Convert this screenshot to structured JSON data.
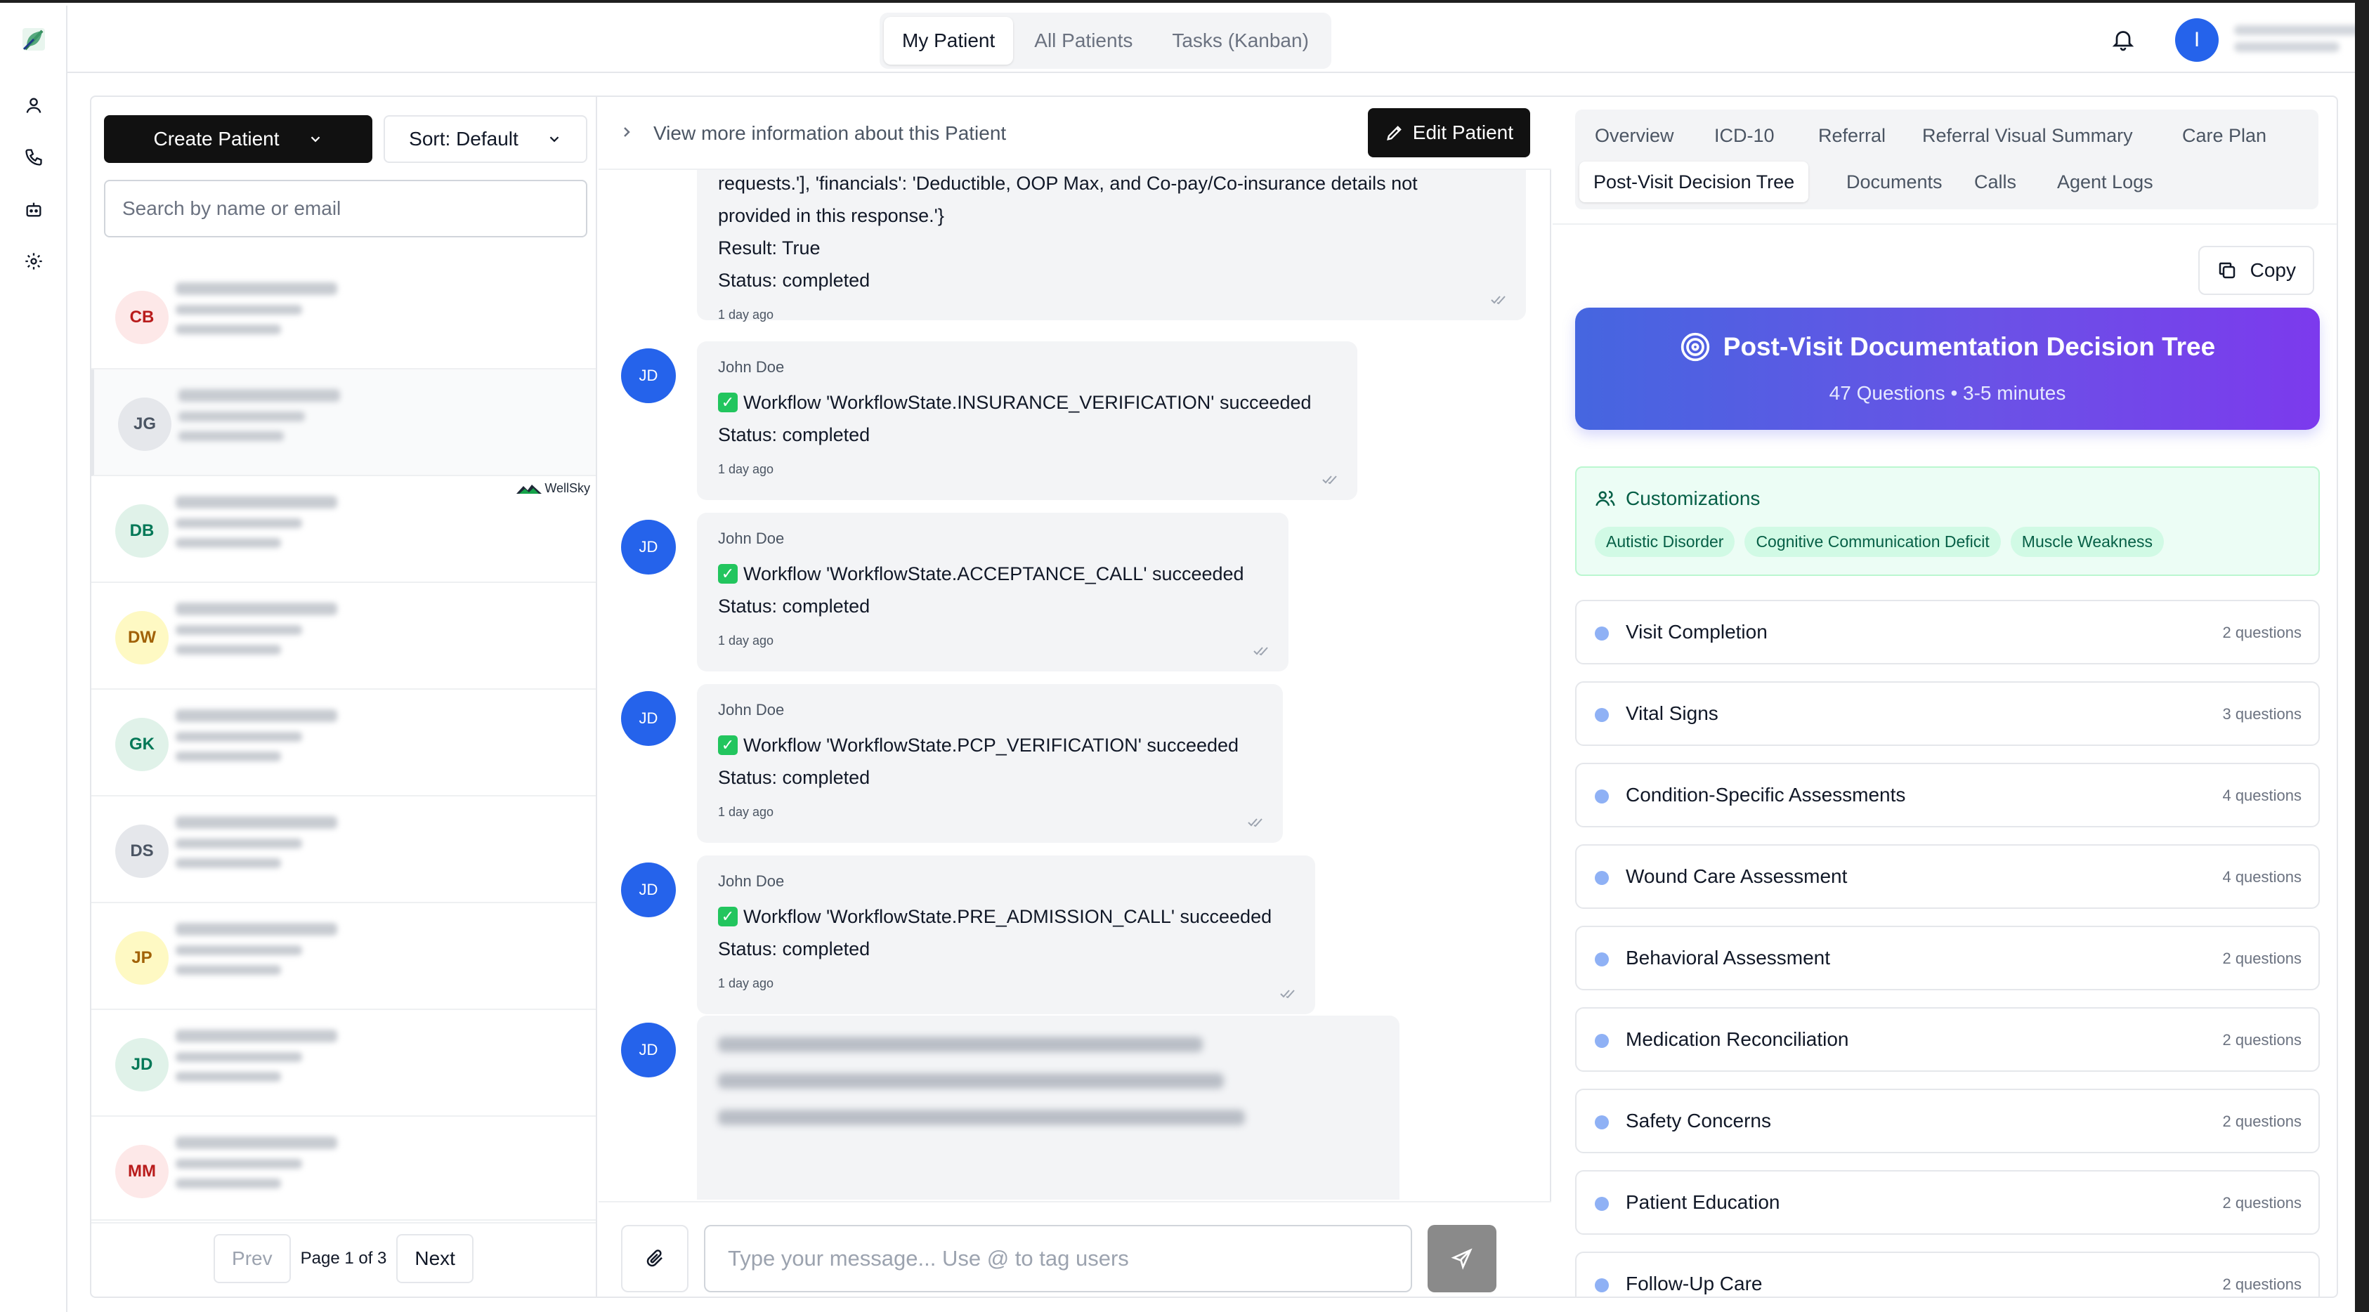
{
  "app": {
    "accent": "#2563eb",
    "brand_icon": "leaf-logo-icon"
  },
  "topbar": {
    "tabs": [
      {
        "label": "My Patient",
        "active": true
      },
      {
        "label": "All Patients",
        "active": false
      },
      {
        "label": "Tasks (Kanban)",
        "active": false
      }
    ],
    "user_initial": "I"
  },
  "patient_list": {
    "create_label": "Create Patient",
    "sort_label": "Sort: Default",
    "search_placeholder": "Search by name or email",
    "patients": [
      {
        "initials": "CB",
        "bg": "#fde8e8",
        "fg": "#b91c1c"
      },
      {
        "initials": "JG",
        "bg": "#e5e7eb",
        "fg": "#4b5563"
      },
      {
        "initials": "DB",
        "bg": "#e0f2e9",
        "fg": "#047857"
      },
      {
        "initials": "DW",
        "bg": "#fef9c3",
        "fg": "#a16207"
      },
      {
        "initials": "GK",
        "bg": "#e0f2e9",
        "fg": "#047857"
      },
      {
        "initials": "DS",
        "bg": "#e5e7eb",
        "fg": "#4b5563"
      },
      {
        "initials": "JP",
        "bg": "#fef9c3",
        "fg": "#a16207"
      },
      {
        "initials": "JD",
        "bg": "#e0f2e9",
        "fg": "#047857"
      },
      {
        "initials": "MM",
        "bg": "#fde8e8",
        "fg": "#b91c1c"
      }
    ],
    "integration_badge": "WellSky",
    "pager": {
      "prev": "Prev",
      "status": "Page 1 of 3",
      "next": "Next"
    }
  },
  "chat": {
    "more_info": "View more information about this Patient",
    "edit_label": "Edit Patient",
    "first_message": {
      "lines": [
        "requests.'],  'financials': 'Deductible, OOP Max, and Co-pay/Co-insurance details not",
        "provided in this response.'}",
        "Result: True",
        "Status: completed"
      ],
      "time": "1 day ago"
    },
    "messages": [
      {
        "initials": "JD",
        "author": "John Doe",
        "text": "Workflow 'WorkflowState.INSURANCE_VERIFICATION' succeeded",
        "status": "Status: completed",
        "time": "1 day ago"
      },
      {
        "initials": "JD",
        "author": "John Doe",
        "text": "Workflow 'WorkflowState.ACCEPTANCE_CALL' succeeded",
        "status": "Status: completed",
        "time": "1 day ago"
      },
      {
        "initials": "JD",
        "author": "John Doe",
        "text": "Workflow 'WorkflowState.PCP_VERIFICATION' succeeded",
        "status": "Status: completed",
        "time": "1 day ago"
      },
      {
        "initials": "JD",
        "author": "John Doe",
        "text": "Workflow 'WorkflowState.PRE_ADMISSION_CALL' succeeded",
        "status": "Status: completed",
        "time": "1 day ago"
      }
    ],
    "last_avatar": "JD",
    "input_placeholder": "Type your message... Use @ to tag users"
  },
  "details": {
    "tabs": [
      {
        "label": "Overview",
        "active": false
      },
      {
        "label": "ICD-10",
        "active": false
      },
      {
        "label": "Referral",
        "active": false
      },
      {
        "label": "Referral Visual Summary",
        "active": false
      },
      {
        "label": "Care Plan",
        "active": false
      },
      {
        "label": "Post-Visit Decision Tree",
        "active": true
      },
      {
        "label": "Documents",
        "active": false
      },
      {
        "label": "Calls",
        "active": false
      },
      {
        "label": "Agent Logs",
        "active": false
      }
    ],
    "copy_label": "Copy",
    "hero": {
      "title": "Post-Visit Documentation Decision Tree",
      "subtitle": "47 Questions • 3-5 minutes"
    },
    "customizations": {
      "title": "Customizations",
      "chips": [
        "Autistic Disorder",
        "Cognitive Communication Deficit",
        "Muscle Weakness"
      ]
    },
    "sections": [
      {
        "label": "Visit Completion",
        "count": "2 questions"
      },
      {
        "label": "Vital Signs",
        "count": "3 questions"
      },
      {
        "label": "Condition-Specific Assessments",
        "count": "4 questions"
      },
      {
        "label": "Wound Care Assessment",
        "count": "4 questions"
      },
      {
        "label": "Behavioral Assessment",
        "count": "2 questions"
      },
      {
        "label": "Medication Reconciliation",
        "count": "2 questions"
      },
      {
        "label": "Safety Concerns",
        "count": "2 questions"
      },
      {
        "label": "Patient Education",
        "count": "2 questions"
      },
      {
        "label": "Follow-Up Care",
        "count": "2 questions"
      }
    ]
  }
}
